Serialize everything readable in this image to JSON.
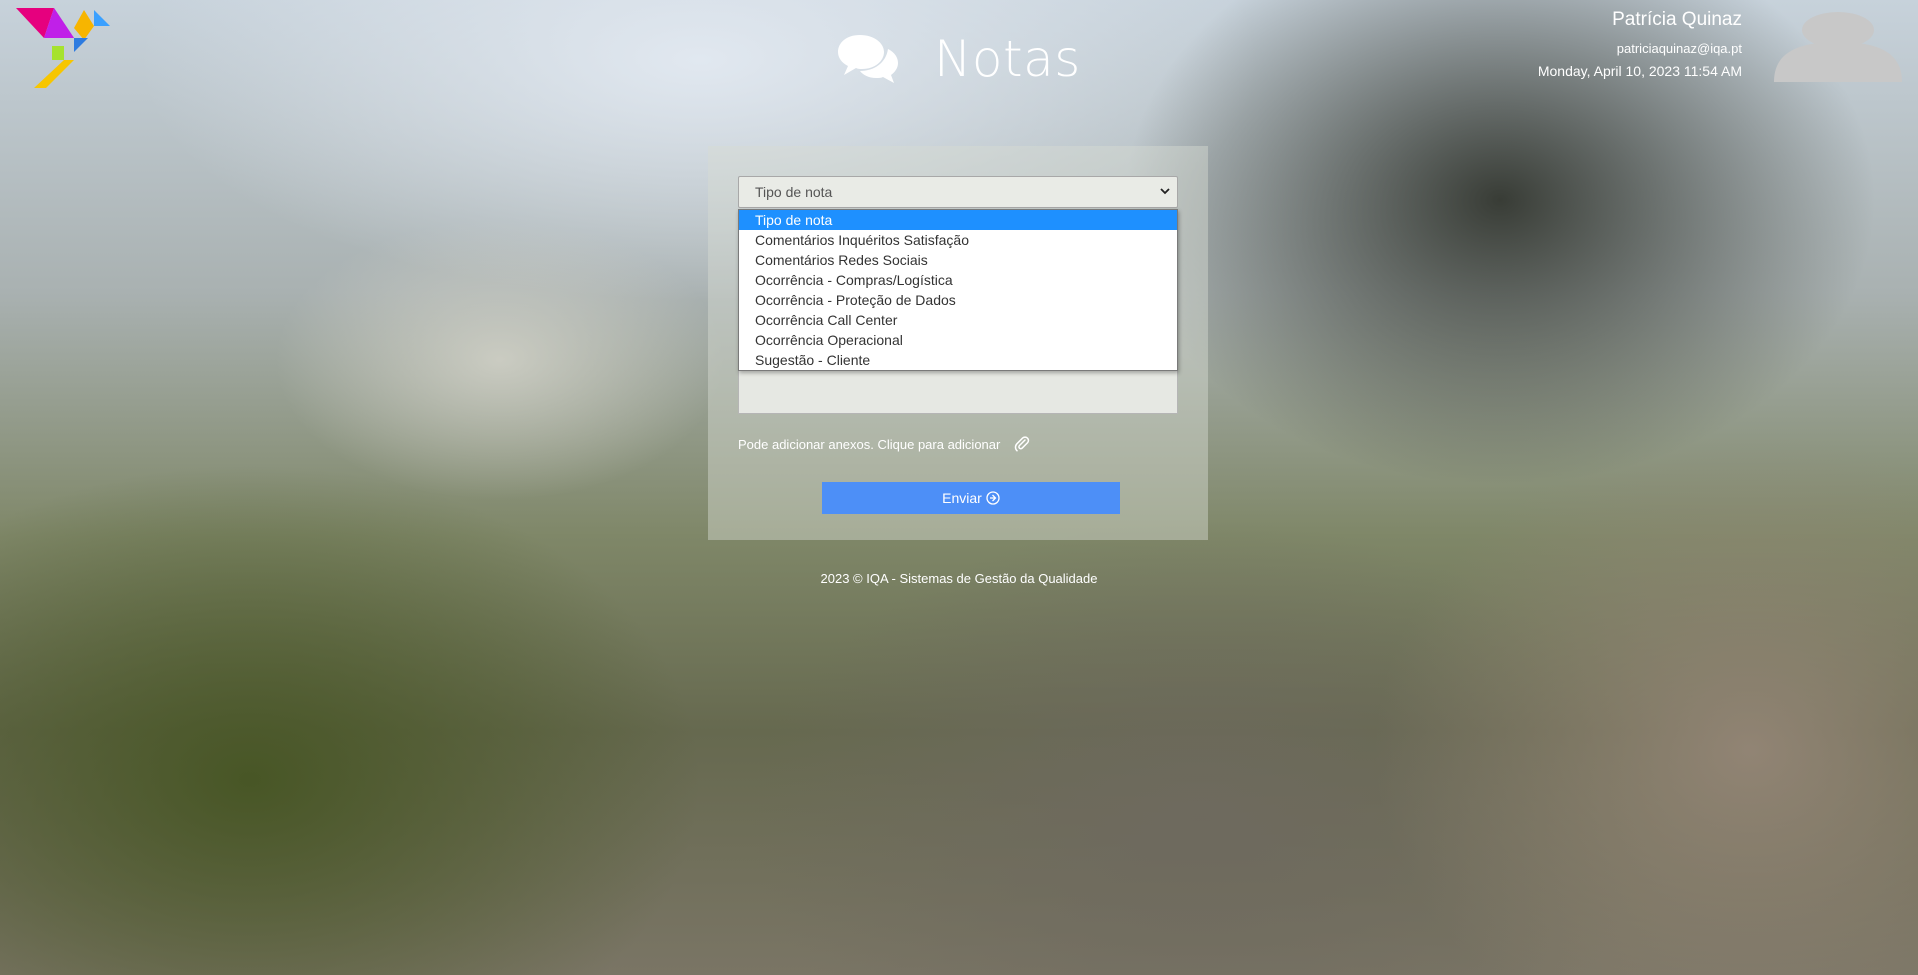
{
  "header": {
    "title": "Notas",
    "logo_icon": "tangram-bird-logo",
    "chat_icon": "chat-bubbles-icon"
  },
  "user": {
    "name": "Patrícia Quinaz",
    "email": "patriciaquinaz@iqa.pt",
    "datetime": "Monday, April 10, 2023 11:54 AM",
    "avatar_icon": "user-avatar-icon"
  },
  "form": {
    "note_type": {
      "selected": "Tipo de nota",
      "options": [
        "Tipo de nota",
        "Comentários Inquéritos Satisfação",
        "Comentários Redes Sociais",
        "Ocorrência - Compras/Logística",
        "Ocorrência - Proteção de Dados",
        "Ocorrência Call Center",
        "Ocorrência Operacional",
        "Sugestão - Cliente"
      ]
    },
    "attachments_text": "Pode adicionar anexos. Clique para adicionar",
    "submit_label": "Enviar"
  },
  "footer": {
    "text": "2023 © IQA - Sistemas de Gestão da Qualidade"
  },
  "colors": {
    "accent": "#4d8ff7",
    "selected_option": "#1e90ff"
  }
}
